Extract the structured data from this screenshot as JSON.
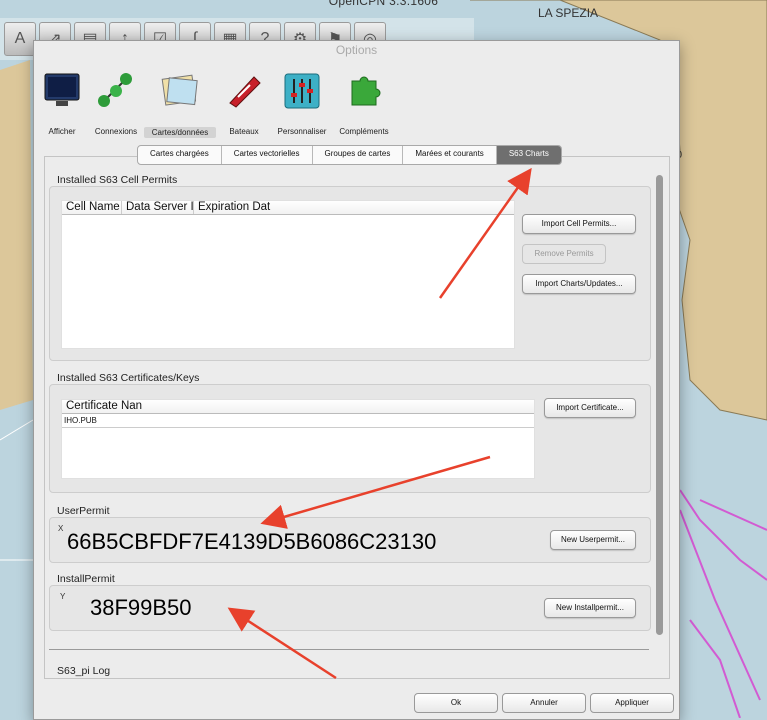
{
  "app": {
    "title": "OpenCPN 3.3.1606"
  },
  "map": {
    "label_1": "LA SPEZIA",
    "label_2": "0"
  },
  "toolbar": {
    "buttons": [
      "zoom-icon",
      "route-icon",
      "chart-quilt-icon",
      "tide-icon",
      "track-icon",
      "ais-icon",
      "print-icon",
      "help-icon",
      "settings-icon",
      "mob-icon",
      "lifebuoy-icon"
    ]
  },
  "dialog": {
    "title": "Options",
    "categories": [
      {
        "label": "Afficher",
        "icon": "monitor-icon"
      },
      {
        "label": "Connexions",
        "icon": "connections-icon"
      },
      {
        "label": "Cartes/données",
        "icon": "charts-icon"
      },
      {
        "label": "Bateaux",
        "icon": "boat-icon"
      },
      {
        "label": "Personnaliser",
        "icon": "sliders-icon"
      },
      {
        "label": "Compléments",
        "icon": "puzzle-icon"
      }
    ],
    "tabs": [
      "Cartes chargées",
      "Cartes vectorielles",
      "Groupes de cartes",
      "Marées et courants",
      "S63 Charts"
    ],
    "active_tab": "S63 Charts"
  },
  "s63": {
    "cell_permits": {
      "title": "Installed S63 Cell Permits",
      "columns": [
        "Cell Name",
        "Data Server ID",
        "Expiration Date"
      ],
      "columns_visible": [
        "Cell Name",
        "Data Server II",
        "Expiration Dat"
      ],
      "rows": [],
      "import_permits": "Import Cell Permits...",
      "remove_permits": "Remove Permits",
      "import_charts": "Import Charts/Updates..."
    },
    "certificates": {
      "title": "Installed S63 Certificates/Keys",
      "column": "Certificate Nan",
      "rows": [
        "IHO.PUB"
      ],
      "import_certificate": "Import Certificate..."
    },
    "userpermit": {
      "title": "UserPermit",
      "prefix": "X",
      "value": "66B5CBFDF7E4139D5B6086C23130",
      "new_button": "New Userpermit..."
    },
    "installpermit": {
      "title": "InstallPermit",
      "prefix": "Y",
      "value": "38F99B50",
      "new_button": "New Installpermit..."
    },
    "log": {
      "title": "S63_pi Log"
    }
  },
  "footer": {
    "ok": "Ok",
    "cancel": "Annuler",
    "apply": "Appliquer"
  },
  "colors": {
    "arrow": "#e8412c",
    "active_tab": "#6f6f6f",
    "land": "#dcc79a",
    "sea": "#bcd4de",
    "route": "#d25bd2"
  }
}
